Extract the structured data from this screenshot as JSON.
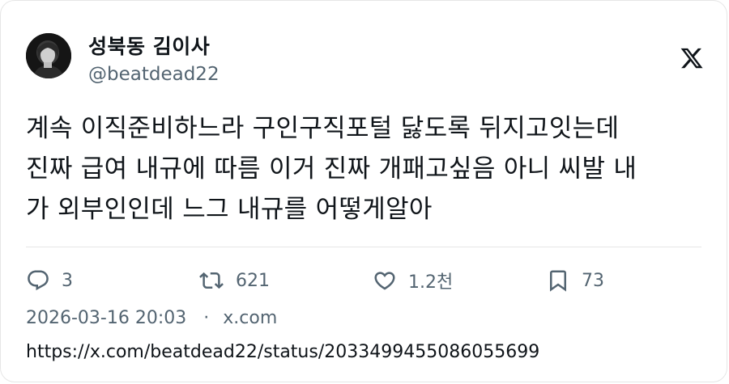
{
  "author": {
    "display_name": "성북동 김이사",
    "handle": "@beatdead22"
  },
  "brand_icon": "x-logo-icon",
  "tweet": {
    "lines": [
      "계속 이직준비하느라 구인구직포털 닳도록 뒤지고잇는데",
      "진짜 급여 내규에 따름 이거 진짜 개패고싶음 아니 씨발 내",
      "가 외부인인데 느그 내규를 어떻게알아"
    ]
  },
  "actions": {
    "replies": {
      "icon": "reply-icon",
      "count": "3"
    },
    "retweets": {
      "icon": "retweet-icon",
      "count": "621"
    },
    "likes": {
      "icon": "heart-icon",
      "count": "1.2천"
    },
    "bookmarks": {
      "icon": "bookmark-icon",
      "count": "73"
    }
  },
  "meta": {
    "timestamp": "2026-03-16 20:03",
    "separator": "·",
    "source": "x.com"
  },
  "url": "https://x.com/beatdead22/status/2033499455086055699",
  "colors": {
    "text": "#0f1419",
    "secondary": "#536471",
    "border": "#e6e6e6"
  }
}
